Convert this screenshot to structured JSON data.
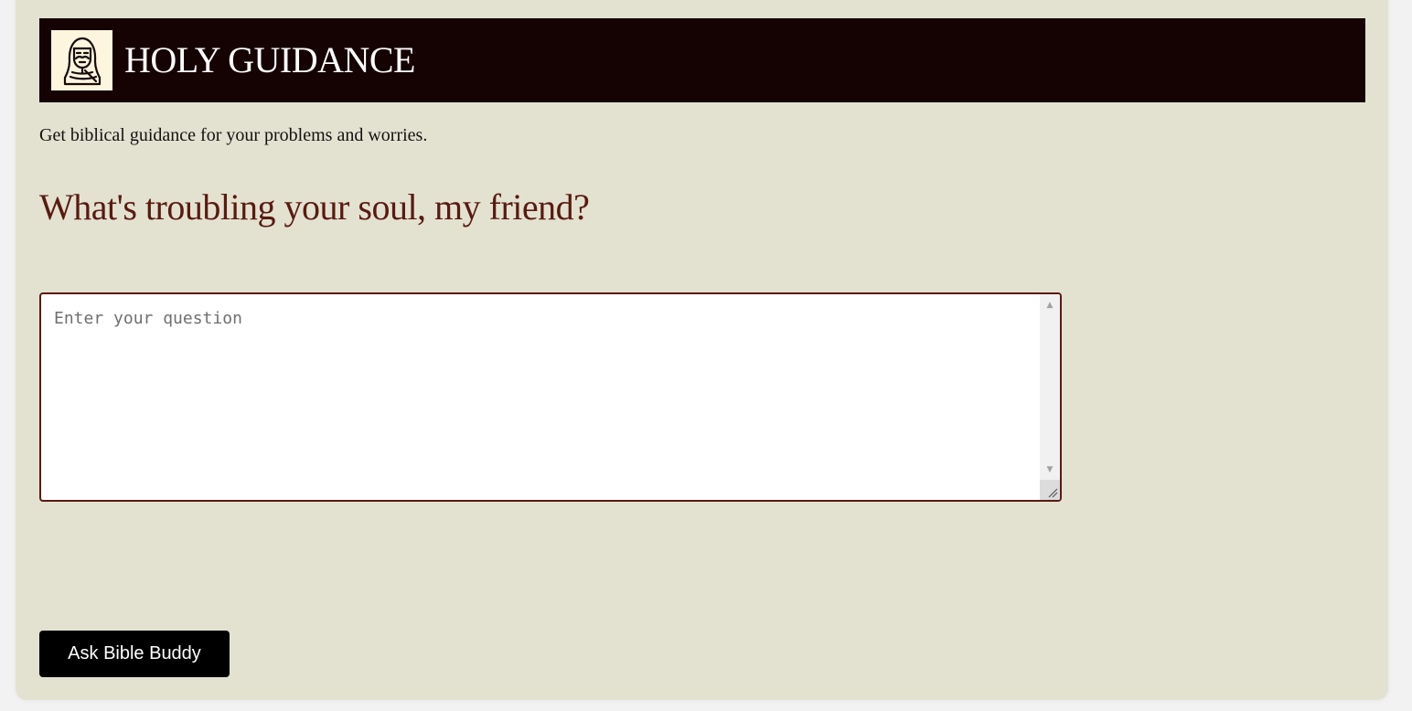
{
  "header": {
    "logo_icon": "bearded-figure-icon",
    "title": "HOLY GUIDANCE"
  },
  "main": {
    "tagline": "Get biblical guidance for your problems and worries.",
    "prompt_heading": "What's troubling your soul, my friend?",
    "question_input": {
      "placeholder": "Enter your question",
      "value": ""
    },
    "submit_label": "Ask Bible Buddy"
  },
  "colors": {
    "page_background": "#f2f2f2",
    "card_background": "#e3e2d1",
    "header_background": "#150203",
    "heading_color": "#5a1a10",
    "input_border": "#5a1a10",
    "button_background": "#000000",
    "button_text": "#ffffff"
  }
}
